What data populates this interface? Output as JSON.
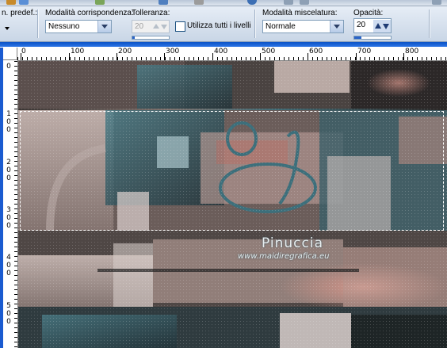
{
  "options_bar": {
    "preset_label": "n. predef.:",
    "match_mode": {
      "label": "Modalità corrispondenza:",
      "value": "Nessuno"
    },
    "tolerance": {
      "label": "Tolleranza:",
      "value": "20",
      "disabled": true
    },
    "use_all_layers": {
      "label": "Utilizza tutti i livelli",
      "checked": false
    },
    "blend_mode": {
      "label": "Modalità miscelatura:",
      "value": "Normale"
    },
    "opacity": {
      "label": "Opacità:",
      "value": "20"
    }
  },
  "ruler_top": {
    "labels": [
      "0",
      "100",
      "200",
      "300",
      "400",
      "500",
      "600",
      "700",
      "800"
    ]
  },
  "ruler_left": {
    "labels": [
      [
        "1",
        "0",
        "0"
      ],
      [
        "2",
        "0",
        "0"
      ],
      [
        "3",
        "0",
        "0"
      ],
      [
        "4",
        "0",
        "0"
      ],
      [
        "5",
        "0",
        "0"
      ]
    ]
  },
  "watermark": {
    "name": "Pinuccia",
    "url": "www.maidiregrafica.eu"
  },
  "colors": {
    "accent": "#0a52c5",
    "teal": "#3d6a76",
    "rose": "#b88a80",
    "dark": "#2b2625"
  }
}
